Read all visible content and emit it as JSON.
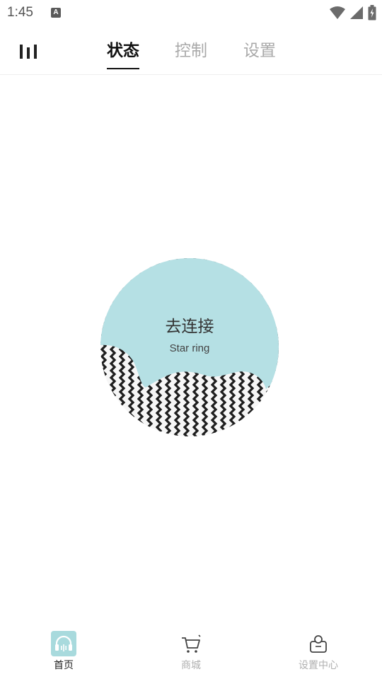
{
  "status_bar": {
    "time": "1:45",
    "notification_letter": "A"
  },
  "top_tabs": [
    {
      "label": "状态",
      "active": true
    },
    {
      "label": "控制",
      "active": false
    },
    {
      "label": "设置",
      "active": false
    }
  ],
  "device_ring": {
    "title": "去连接",
    "subtitle": "Star ring",
    "fill_color": "#b5e0e4"
  },
  "bottom_nav": [
    {
      "label": "首页",
      "icon": "headphones-icon",
      "active": true
    },
    {
      "label": "商城",
      "icon": "cart-icon",
      "active": false
    },
    {
      "label": "设置中心",
      "icon": "user-center-icon",
      "active": false
    }
  ],
  "colors": {
    "accent": "#a8dadd",
    "active_text": "#111111",
    "inactive_text": "#a9a9a9"
  }
}
